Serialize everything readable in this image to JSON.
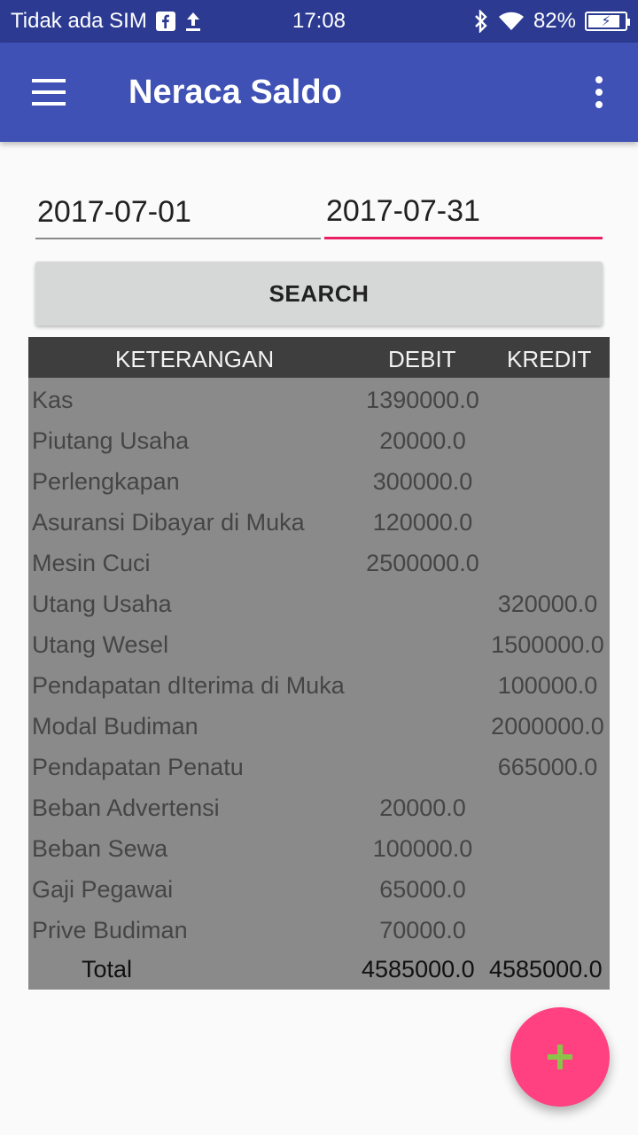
{
  "status_bar": {
    "carrier": "Tidak ada SIM",
    "time": "17:08",
    "battery": "82%",
    "icons": [
      "facebook-icon",
      "upload-icon",
      "bluetooth-icon",
      "wifi-icon",
      "battery-charging-icon"
    ]
  },
  "app_bar": {
    "title": "Neraca Saldo",
    "menu_icon": "hamburger-menu-icon",
    "overflow_icon": "more-vert-icon",
    "color": "#3f51b5"
  },
  "filter": {
    "start_date": "2017-07-01",
    "end_date": "2017-07-31",
    "search_label": "SEARCH"
  },
  "table": {
    "headers": {
      "keterangan": "KETERANGAN",
      "debit": "DEBIT",
      "kredit": "KREDIT"
    },
    "rows": [
      {
        "keterangan": "Kas",
        "debit": "1390000.0",
        "kredit": ""
      },
      {
        "keterangan": "Piutang Usaha",
        "debit": "20000.0",
        "kredit": ""
      },
      {
        "keterangan": "Perlengkapan",
        "debit": "300000.0",
        "kredit": ""
      },
      {
        "keterangan": "Asuransi Dibayar di Muka",
        "debit": "120000.0",
        "kredit": ""
      },
      {
        "keterangan": "Mesin Cuci",
        "debit": "2500000.0",
        "kredit": ""
      },
      {
        "keterangan": "Utang Usaha",
        "debit": "",
        "kredit": "320000.0"
      },
      {
        "keterangan": "Utang Wesel",
        "debit": "",
        "kredit": "1500000.0"
      },
      {
        "keterangan": "Pendapatan dIterima di Muka",
        "debit": "",
        "kredit": "100000.0"
      },
      {
        "keterangan": "Modal Budiman",
        "debit": "",
        "kredit": "2000000.0"
      },
      {
        "keterangan": "Pendapatan Penatu",
        "debit": "",
        "kredit": "665000.0"
      },
      {
        "keterangan": "Beban Advertensi",
        "debit": "20000.0",
        "kredit": ""
      },
      {
        "keterangan": "Beban Sewa",
        "debit": "100000.0",
        "kredit": ""
      },
      {
        "keterangan": "Gaji Pegawai",
        "debit": "65000.0",
        "kredit": ""
      },
      {
        "keterangan": "Prive Budiman",
        "debit": "70000.0",
        "kredit": ""
      }
    ],
    "total": {
      "label": "Total",
      "debit": "4585000.0",
      "kredit": "4585000.0"
    }
  },
  "fab": {
    "icon": "plus-icon",
    "color": "#ff4081",
    "icon_color": "#8bc34a"
  },
  "colors": {
    "status_bar": "#2c3b91",
    "accent": "#e91e63",
    "table_header": "#3e3e3e",
    "table_body": "#8a8a8a"
  }
}
